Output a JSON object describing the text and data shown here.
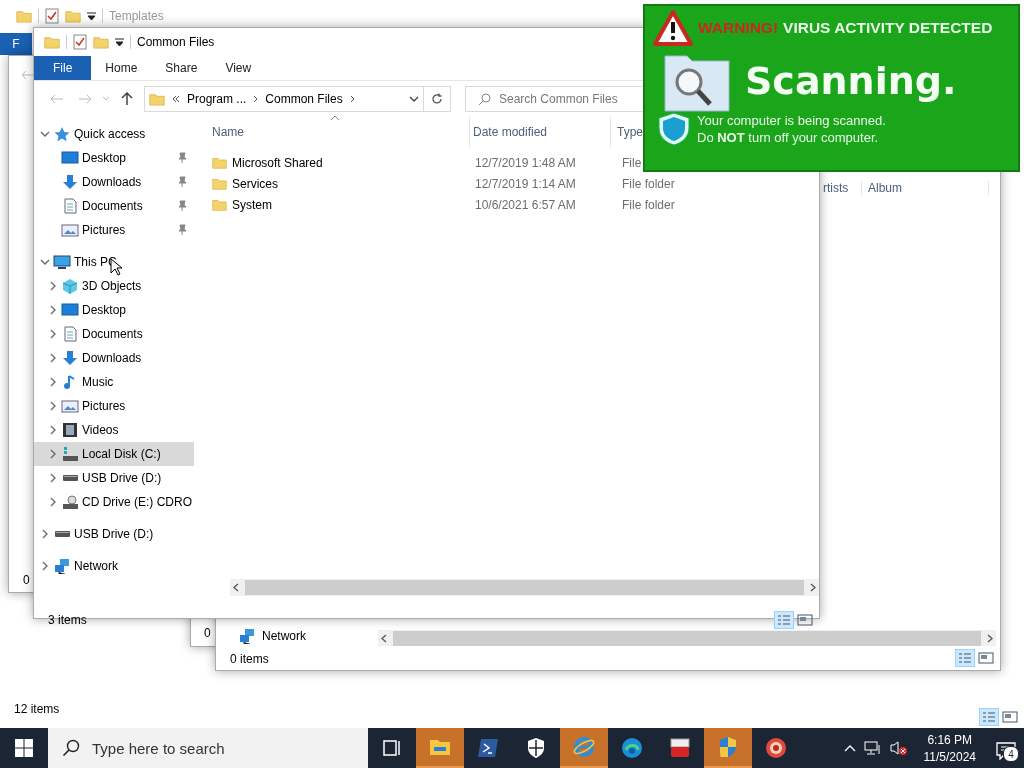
{
  "background_window": {
    "title": "Templates",
    "file_tab": "F",
    "status": "12 items"
  },
  "side_window": {
    "status": "0"
  },
  "lower_window": {
    "status": "0"
  },
  "music_window": {
    "columns": [
      "rtists",
      "Album"
    ],
    "nav_item": "Network",
    "status": "0 items"
  },
  "explorer": {
    "title": "Common Files",
    "tabs": [
      {
        "label": "File",
        "selected": true
      },
      {
        "label": "Home",
        "selected": false
      },
      {
        "label": "Share",
        "selected": false
      },
      {
        "label": "View",
        "selected": false
      }
    ],
    "address": {
      "parts": [
        "Program ...",
        "Common Files"
      ]
    },
    "search": {
      "placeholder": "Search Common Files"
    },
    "columns": [
      "Name",
      "Date modified",
      "Type"
    ],
    "rows": [
      {
        "name": "Microsoft Shared",
        "date": "12/7/2019 1:48 AM",
        "type": "File"
      },
      {
        "name": "Services",
        "date": "12/7/2019 1:14 AM",
        "type": "File folder"
      },
      {
        "name": "System",
        "date": "10/6/2021 6:57 AM",
        "type": "File folder"
      }
    ],
    "nav": [
      {
        "label": "Quick access",
        "expanded": true,
        "selected": false,
        "children": [
          {
            "label": "Desktop",
            "pinned": true,
            "selected": false
          },
          {
            "label": "Downloads",
            "pinned": true,
            "selected": false
          },
          {
            "label": "Documents",
            "pinned": true,
            "selected": false
          },
          {
            "label": "Pictures",
            "pinned": true,
            "selected": false
          }
        ]
      },
      {
        "label": "This PC",
        "expanded": true,
        "selected": false,
        "children": [
          {
            "label": "3D Objects",
            "expanded": false,
            "selected": false
          },
          {
            "label": "Desktop",
            "expanded": false,
            "selected": false
          },
          {
            "label": "Documents",
            "expanded": false,
            "selected": false
          },
          {
            "label": "Downloads",
            "expanded": false,
            "selected": false
          },
          {
            "label": "Music",
            "expanded": false,
            "selected": false
          },
          {
            "label": "Pictures",
            "expanded": false,
            "selected": false
          },
          {
            "label": "Videos",
            "expanded": false,
            "selected": false
          },
          {
            "label": "Local Disk (C:)",
            "expanded": false,
            "selected": true
          },
          {
            "label": "USB Drive (D:)",
            "expanded": false,
            "selected": false
          },
          {
            "label": "CD Drive (E:) CDRO",
            "expanded": false,
            "selected": false
          }
        ]
      },
      {
        "label": "USB Drive (D:)",
        "expanded": false,
        "selected": false
      },
      {
        "label": "Network",
        "expanded": false,
        "selected": false
      }
    ],
    "status": "3 items"
  },
  "popup": {
    "warning": "WARNING!",
    "headline": "VIRUS ACTIVITY DETECTED",
    "title": "Scanning.",
    "lines": [
      "Your computer is being scanned.",
      "Do **NOT** turn off your computer."
    ]
  },
  "taskbar": {
    "search_placeholder": "Type here to search",
    "apps": [
      {
        "kind": "taskview",
        "highlighted": false
      },
      {
        "kind": "explorer",
        "highlighted": true
      },
      {
        "kind": "powershell",
        "highlighted": false
      },
      {
        "kind": "defender",
        "highlighted": false
      },
      {
        "kind": "ie",
        "highlighted": true
      },
      {
        "kind": "edge",
        "highlighted": false
      },
      {
        "kind": "toolbox",
        "highlighted": false
      },
      {
        "kind": "uac",
        "highlighted": true
      },
      {
        "kind": "redapp",
        "highlighted": false
      }
    ],
    "time": "6:16 PM",
    "date": "11/5/2024",
    "notifications": "4"
  }
}
